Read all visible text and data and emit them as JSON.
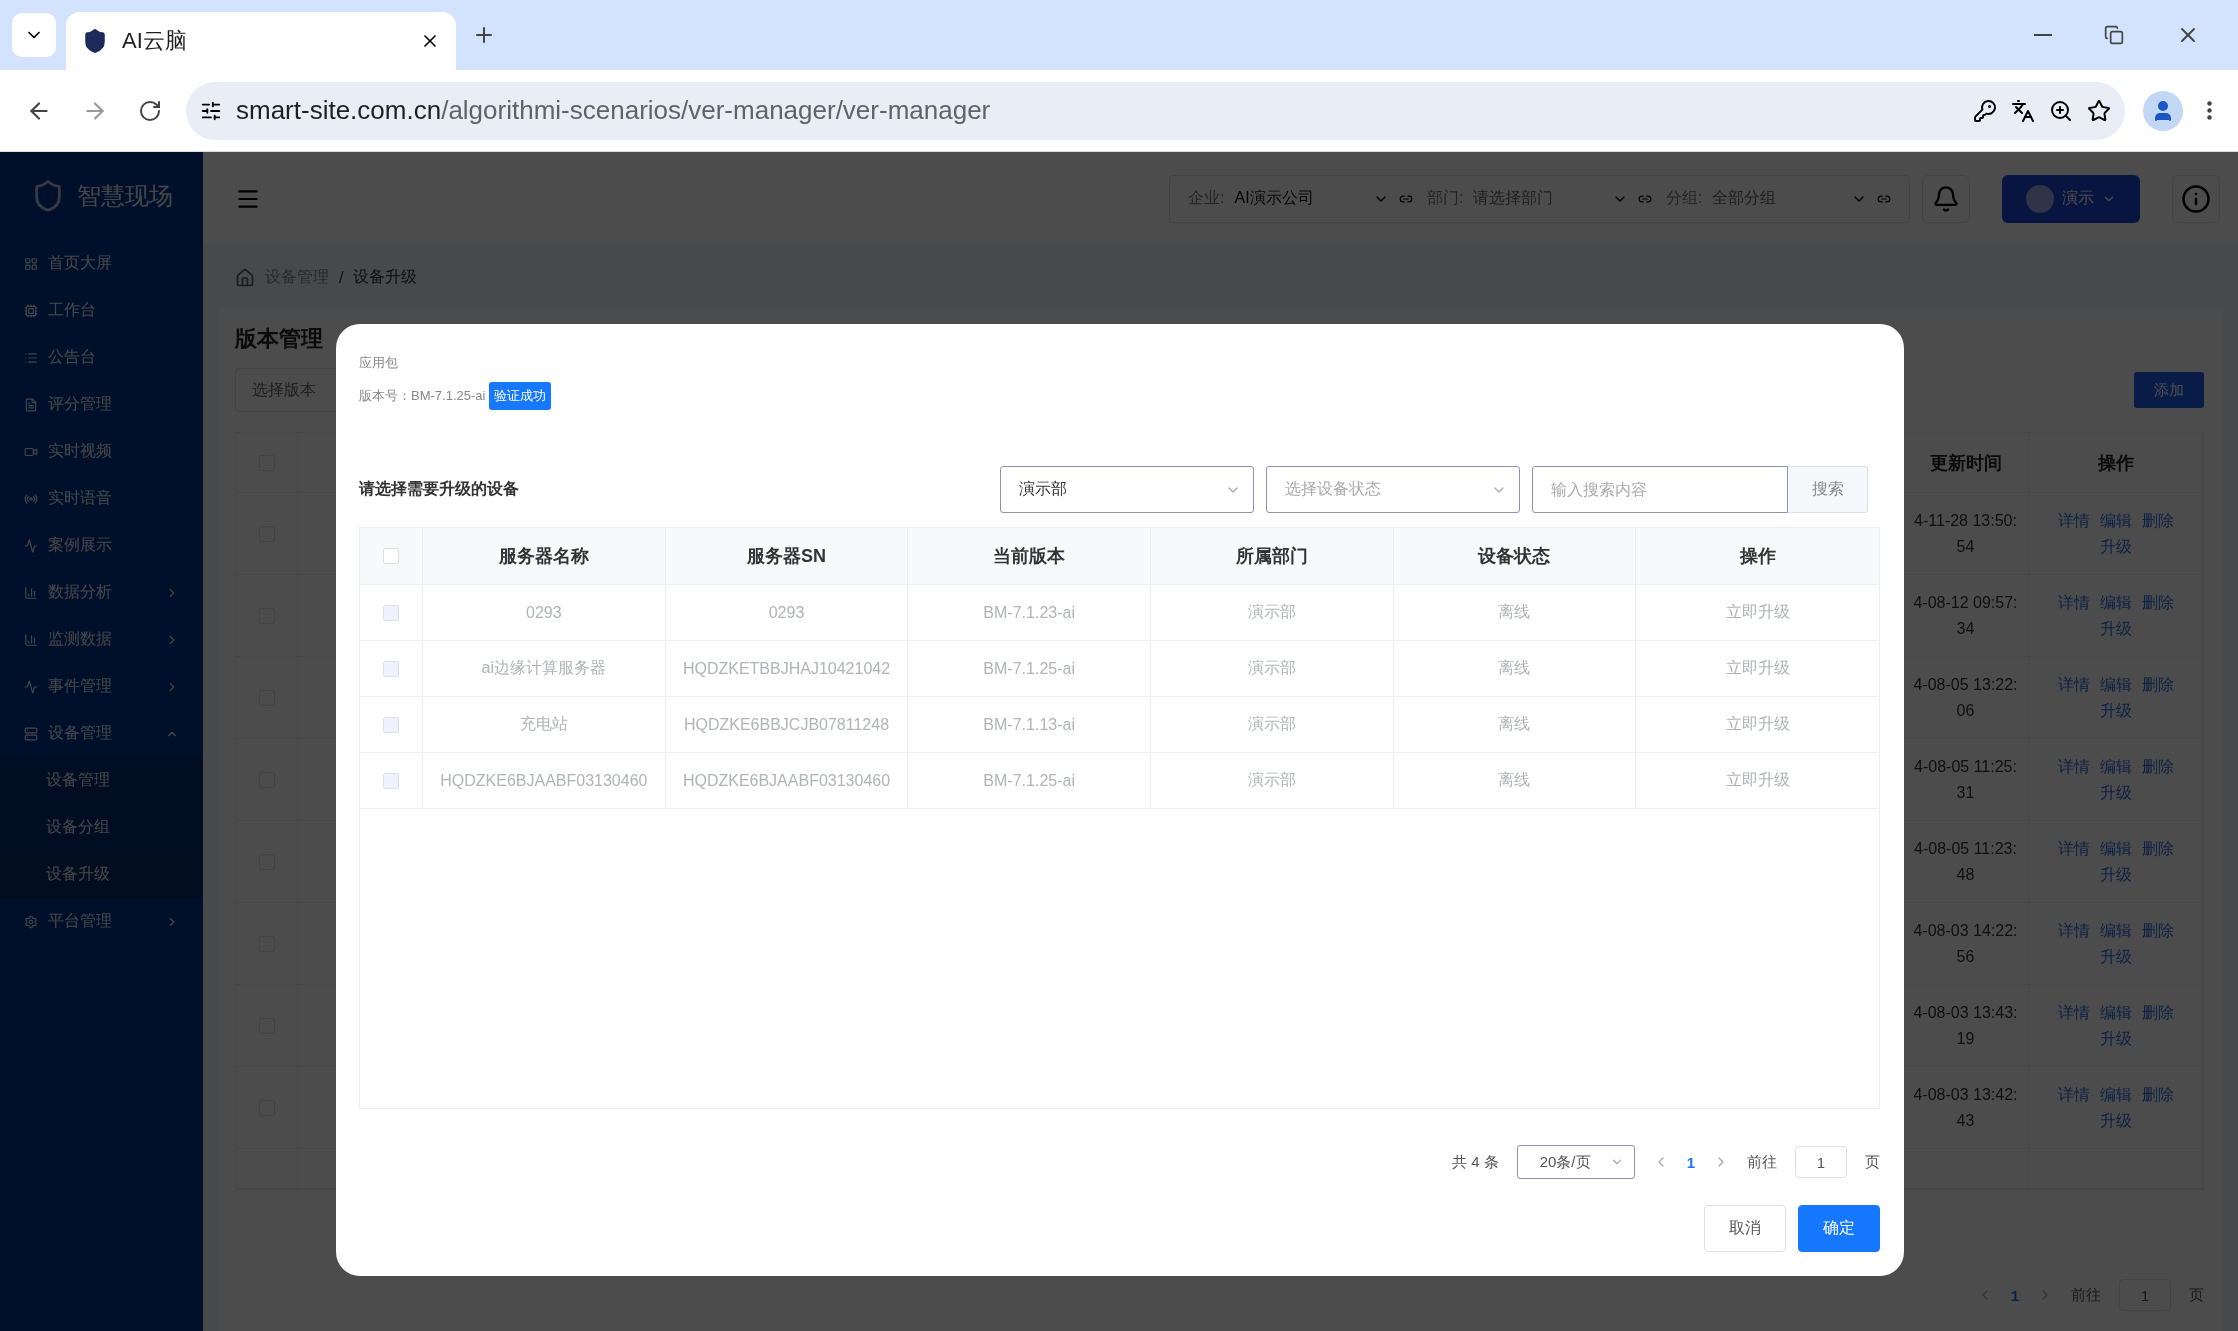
{
  "browser": {
    "tab_title": "AI云脑",
    "url_host": "smart-site.com.cn",
    "url_path": "/algorithmi-scenarios/ver-manager/ver-manager"
  },
  "sidebar": {
    "logo": "智慧现场",
    "items": [
      {
        "label": "首页大屏"
      },
      {
        "label": "工作台"
      },
      {
        "label": "公告台"
      },
      {
        "label": "评分管理"
      },
      {
        "label": "实时视频"
      },
      {
        "label": "实时语音"
      },
      {
        "label": "案例展示"
      },
      {
        "label": "数据分析",
        "expanded": false
      },
      {
        "label": "监测数据",
        "expanded": false
      },
      {
        "label": "事件管理",
        "expanded": false
      },
      {
        "label": "设备管理",
        "expanded": true,
        "children": [
          {
            "label": "设备管理",
            "selected": false
          },
          {
            "label": "设备分组",
            "selected": false
          },
          {
            "label": "设备升级",
            "selected": true
          }
        ]
      },
      {
        "label": "平台管理",
        "expanded": false
      }
    ]
  },
  "header": {
    "filters": [
      {
        "label": "企业:",
        "value": "AI演示公司"
      },
      {
        "label": "部门:",
        "placeholder": "请选择部门"
      },
      {
        "label": "分组:",
        "placeholder": "全部分组"
      }
    ],
    "user": "演示"
  },
  "breadcrumb": [
    "设备管理",
    "设备升级"
  ],
  "breadcrumb_separator": "/",
  "page": {
    "title": "版本管理",
    "version_select": {
      "placeholder": "选择版本"
    },
    "add_button": "添加",
    "table": {
      "columns": [
        "更新时间",
        "操作"
      ],
      "header_checked": false,
      "rows": [
        {
          "checked": false,
          "update_time": "4-11-28 13:50:54",
          "actions": [
            "详情",
            "编辑",
            "删除",
            "升级"
          ]
        },
        {
          "checked": false,
          "update_time": "4-08-12 09:57:34",
          "actions": [
            "详情",
            "编辑",
            "删除",
            "升级"
          ]
        },
        {
          "checked": false,
          "update_time": "4-08-05 13:22:06",
          "actions": [
            "详情",
            "编辑",
            "删除",
            "升级"
          ]
        },
        {
          "checked": false,
          "update_time": "4-08-05 11:25:31",
          "actions": [
            "详情",
            "编辑",
            "删除",
            "升级"
          ]
        },
        {
          "checked": false,
          "update_time": "4-08-05 11:23:48",
          "actions": [
            "详情",
            "编辑",
            "删除",
            "升级"
          ]
        },
        {
          "checked": false,
          "update_time": "4-08-03 14:22:56",
          "actions": [
            "详情",
            "编辑",
            "删除",
            "升级"
          ]
        },
        {
          "checked": false,
          "update_time": "4-08-03 13:43:19",
          "actions": [
            "详情",
            "编辑",
            "删除",
            "升级"
          ]
        },
        {
          "checked": false,
          "update_time": "4-08-03 13:42:43",
          "actions": [
            "详情",
            "编辑",
            "删除",
            "升级"
          ]
        }
      ]
    },
    "pagination": {
      "pages": [
        {
          "label": "1",
          "selected": true
        }
      ],
      "goto_label": "前往",
      "goto_value": "1",
      "page_suffix": "页"
    }
  },
  "dialog": {
    "package_label": "应用包",
    "version_text": "版本号：BM-7.1.25-ai",
    "verify_badge": "验证成功",
    "section_title": "请选择需要升级的设备",
    "dept_select": {
      "value": "演示部"
    },
    "status_select": {
      "placeholder": "选择设备状态"
    },
    "search": {
      "placeholder": "输入搜索内容"
    },
    "search_button": "搜索",
    "table": {
      "columns": [
        "服务器名称",
        "服务器SN",
        "当前版本",
        "所属部门",
        "设备状态",
        "操作"
      ],
      "header_checked": false,
      "rows": [
        {
          "checked": false,
          "disabled": true,
          "cells": [
            "0293",
            "0293",
            "BM-7.1.23-ai",
            "演示部",
            "离线"
          ],
          "action": "立即升级"
        },
        {
          "checked": false,
          "disabled": true,
          "cells": [
            "ai边缘计算服务器",
            "HQDZKETBBJHAJ10421042",
            "BM-7.1.25-ai",
            "演示部",
            "离线"
          ],
          "action": "立即升级"
        },
        {
          "checked": false,
          "disabled": true,
          "cells": [
            "充电站",
            "HQDZKE6BBJCJB07811248",
            "BM-7.1.13-ai",
            "演示部",
            "离线"
          ],
          "action": "立即升级"
        },
        {
          "checked": false,
          "disabled": true,
          "cells": [
            "HQDZKE6BJAABF03130460",
            "HQDZKE6BJAABF03130460",
            "BM-7.1.25-ai",
            "演示部",
            "离线"
          ],
          "action": "立即升级"
        }
      ]
    },
    "pagination": {
      "total": "共 4 条",
      "page_size": "20条/页",
      "pages": [
        {
          "label": "1",
          "selected": true
        }
      ],
      "goto_label": "前往",
      "goto_value": "1",
      "page_suffix": "页"
    },
    "buttons": [
      {
        "label": "取消",
        "kind": "secondary"
      },
      {
        "label": "确定",
        "kind": "primary"
      }
    ]
  }
}
